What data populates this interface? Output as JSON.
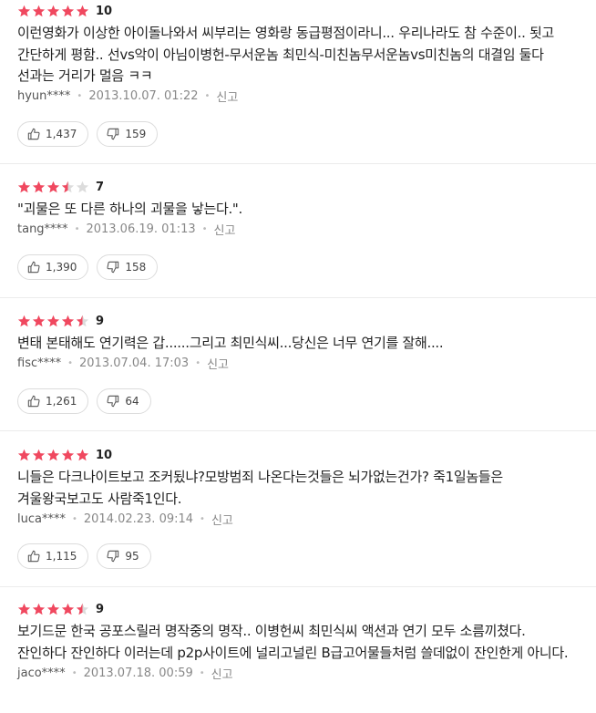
{
  "colors": {
    "star_filled": "#f0485f",
    "star_empty": "#dcdcdc"
  },
  "reviews": [
    {
      "rating_stars": 5,
      "score": "10",
      "text": "이런영화가 이상한 아이돌나와서 씨부리는 영화랑 동급평점이라니... 우리나라도 참 수준이.. 됫고 간단하게 평함.. 선vs악이 아님이병헌-무서운놈 최민식-미친놈무서운놈vs미친놈의 대결임 둘다 선과는 거리가 멀음 ㅋㅋ",
      "user": "hyun****",
      "date": "2013.10.07. 01:22",
      "report": "신고",
      "likes": "1,437",
      "dislikes": "159"
    },
    {
      "rating_stars": 3.5,
      "score": "7",
      "text": "\"괴물은 또 다른 하나의 괴물을 낳는다.\".",
      "user": "tang****",
      "date": "2013.06.19. 01:13",
      "report": "신고",
      "likes": "1,390",
      "dislikes": "158"
    },
    {
      "rating_stars": 4.5,
      "score": "9",
      "text": "변태 본태해도 연기력은 갑......그리고 최민식씨...당신은 너무 연기를 잘해....",
      "user": "fisc****",
      "date": "2013.07.04. 17:03",
      "report": "신고",
      "likes": "1,261",
      "dislikes": "64"
    },
    {
      "rating_stars": 5,
      "score": "10",
      "text": "니들은 다크나이트보고 조커됬냐?모방범죄 나온다는것들은 뇌가없는건가? 죽1일놈들은 겨울왕국보고도 사람죽1인다.",
      "user": "luca****",
      "date": "2014.02.23. 09:14",
      "report": "신고",
      "likes": "1,115",
      "dislikes": "95"
    },
    {
      "rating_stars": 4.5,
      "score": "9",
      "text": "보기드문 한국 공포스릴러 명작중의 명작.. 이병헌씨 최민식씨 액션과 연기 모두 소름끼쳤다. 잔인하다 잔인하다 이러는데 p2p사이트에 널리고널린 B급고어물들처럼 쓸데없이 잔인한게 아니다.",
      "user": "jaco****",
      "date": "2013.07.18. 00:59",
      "report": "신고",
      "likes": "",
      "dislikes": ""
    }
  ]
}
